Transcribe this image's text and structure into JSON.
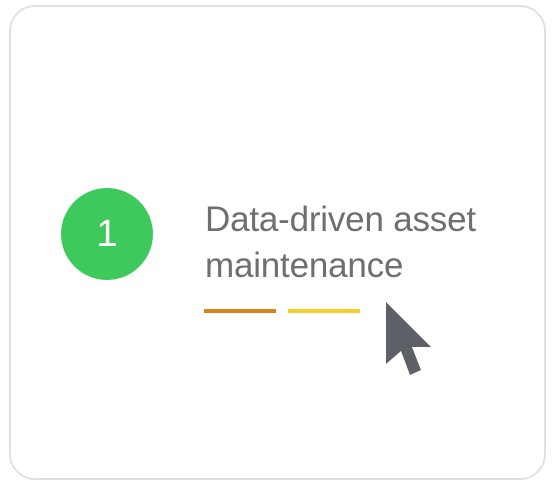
{
  "card": {
    "step_number": "1",
    "title_line1": "Data-driven asset",
    "title_line2": "maintenance"
  },
  "colors": {
    "badge": "#3ec95c",
    "accent_orange": "#d6841d",
    "accent_yellow": "#f3cf27",
    "cursor": "#5e6067",
    "border": "#e1e1e1"
  },
  "icons": {
    "pointer": "mouse-pointer-icon"
  }
}
